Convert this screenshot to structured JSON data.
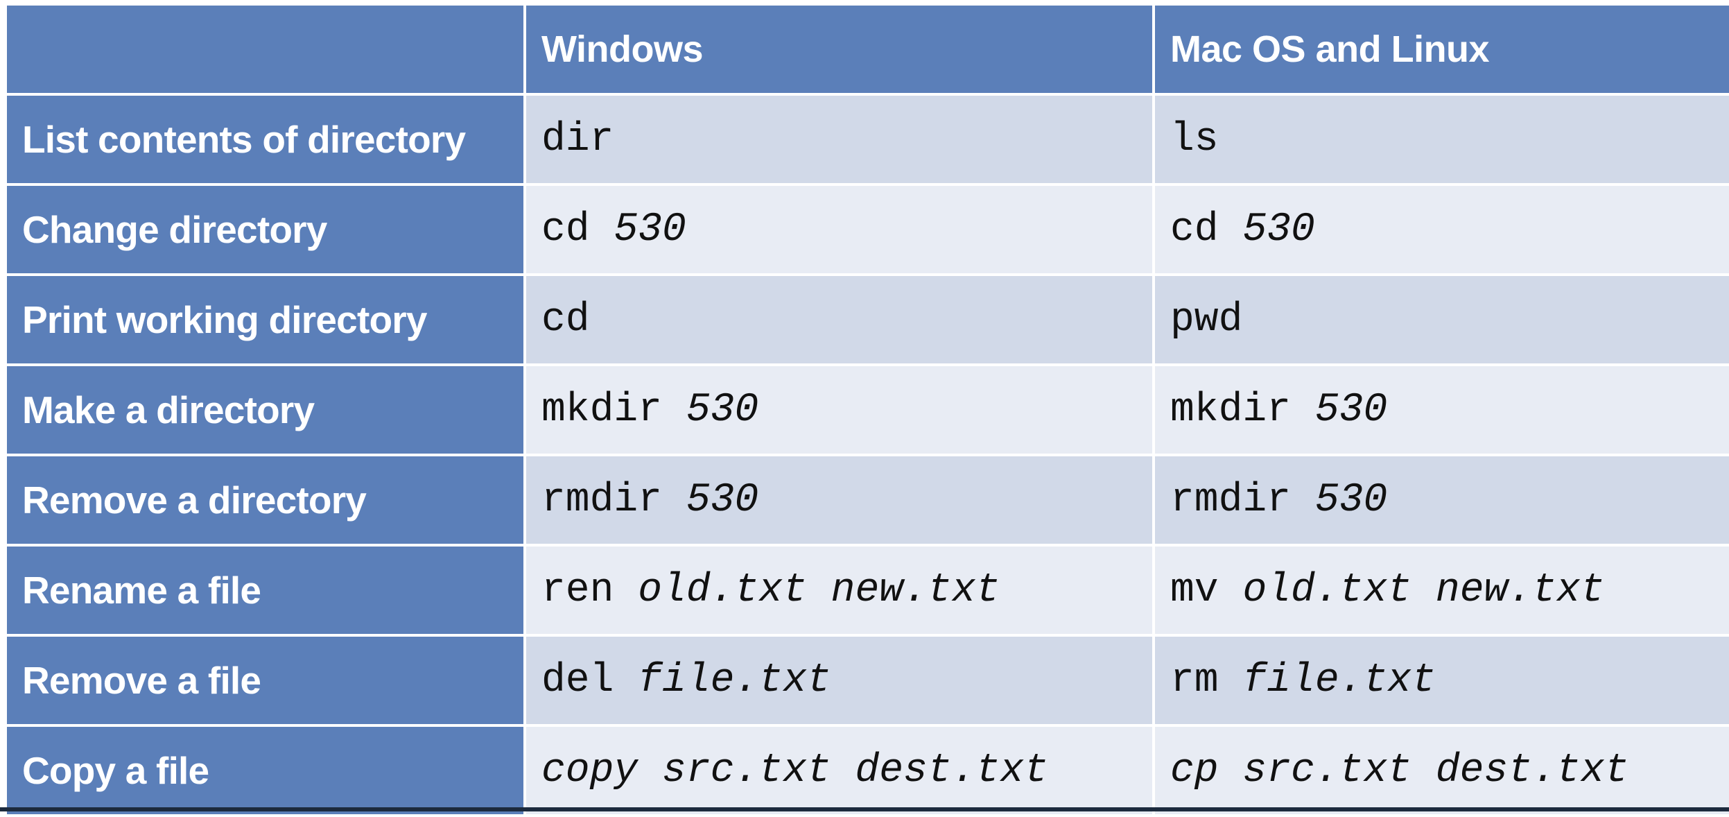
{
  "table": {
    "headers": [
      "",
      "Windows",
      "Mac OS and Linux"
    ],
    "rows": [
      {
        "label": "List contents of directory",
        "windows": {
          "cmd": "dir",
          "args": ""
        },
        "unix": {
          "cmd": "ls",
          "args": ""
        }
      },
      {
        "label": "Change directory",
        "windows": {
          "cmd": "cd",
          "args": "530"
        },
        "unix": {
          "cmd": "cd",
          "args": "530"
        }
      },
      {
        "label": "Print working directory",
        "windows": {
          "cmd": "cd",
          "args": ""
        },
        "unix": {
          "cmd": "pwd",
          "args": ""
        }
      },
      {
        "label": "Make a directory",
        "windows": {
          "cmd": "mkdir",
          "args": "530"
        },
        "unix": {
          "cmd": "mkdir",
          "args": "530"
        }
      },
      {
        "label": "Remove a directory",
        "windows": {
          "cmd": "rmdir",
          "args": "530"
        },
        "unix": {
          "cmd": "rmdir",
          "args": "530"
        }
      },
      {
        "label": "Rename a file",
        "windows": {
          "cmd": "ren",
          "args": "old.txt new.txt"
        },
        "unix": {
          "cmd": "mv",
          "args": "old.txt new.txt"
        }
      },
      {
        "label": "Remove a file",
        "windows": {
          "cmd": "del",
          "args": "file.txt"
        },
        "unix": {
          "cmd": "rm",
          "args": "file.txt"
        }
      },
      {
        "label": "Copy a file",
        "windows": {
          "cmd": "",
          "args": "copy src.txt dest.txt"
        },
        "unix": {
          "cmd": "",
          "args": "cp src.txt dest.txt"
        }
      }
    ]
  },
  "colors": {
    "header_bg": "#5b7fb9",
    "row_band_dark": "#d1d9e8",
    "row_band_light": "#e8ecf4",
    "header_text": "#ffffff"
  }
}
